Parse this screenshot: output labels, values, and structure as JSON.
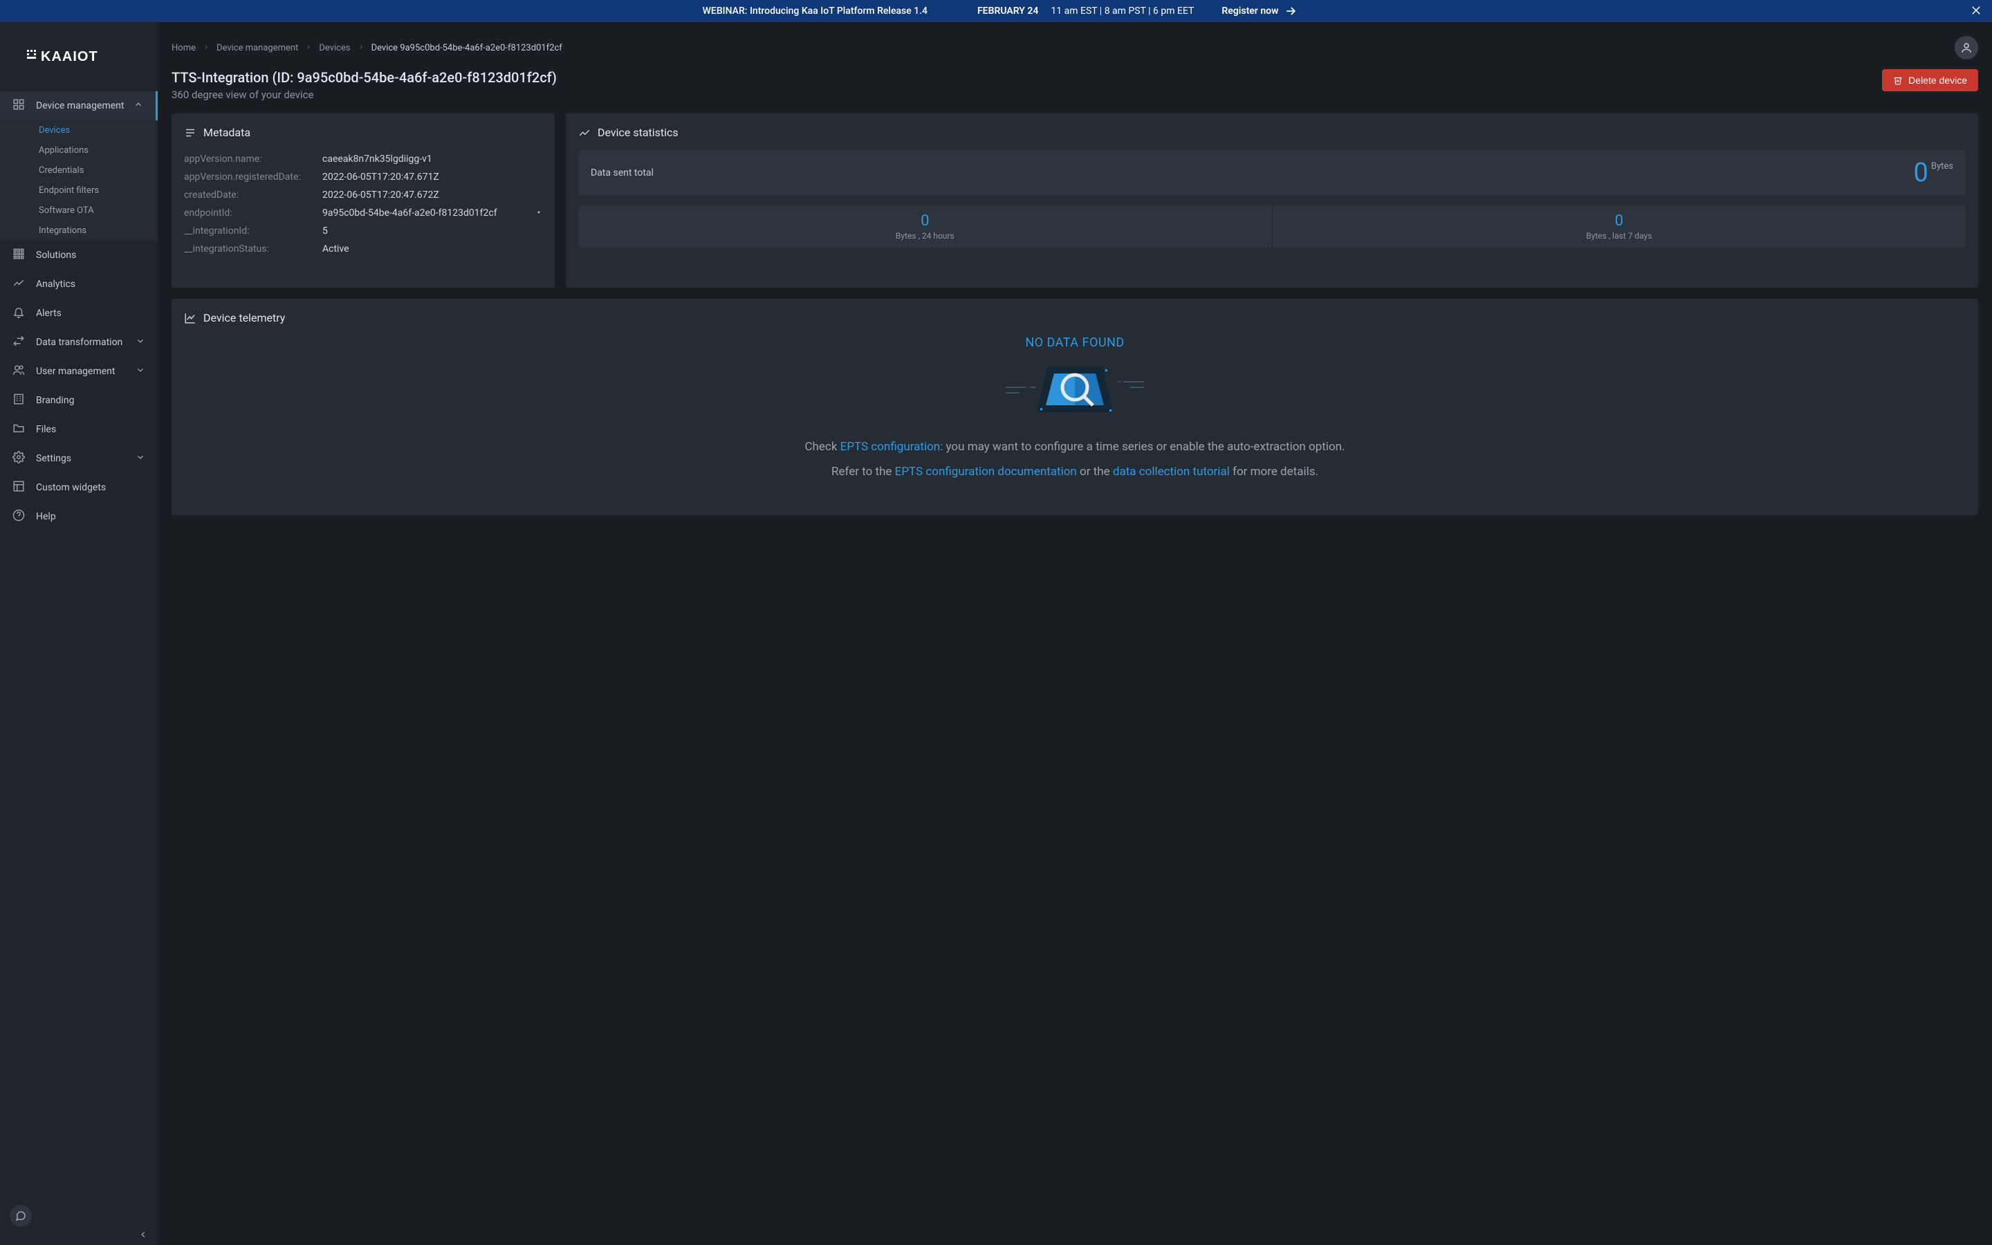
{
  "banner": {
    "text": "WEBINAR: Introducing Kaa IoT Platform Release 1.4",
    "date": "FEBRUARY 24",
    "times": "11 am EST   |   8 am PST   |   6 pm EET",
    "register": "Register now"
  },
  "brand": "KAAIOT",
  "sidebar": {
    "items": [
      {
        "label": "Device management",
        "icon": "grid-icon",
        "expandable": true,
        "active": true,
        "children": [
          {
            "label": "Devices",
            "active": true
          },
          {
            "label": "Applications"
          },
          {
            "label": "Credentials"
          },
          {
            "label": "Endpoint filters"
          },
          {
            "label": "Software OTA"
          },
          {
            "label": "Integrations"
          }
        ]
      },
      {
        "label": "Solutions",
        "icon": "grid3-icon"
      },
      {
        "label": "Analytics",
        "icon": "trend-icon"
      },
      {
        "label": "Alerts",
        "icon": "bell-icon"
      },
      {
        "label": "Data transformation",
        "icon": "swap-icon",
        "expandable": true
      },
      {
        "label": "User management",
        "icon": "people-icon",
        "expandable": true
      },
      {
        "label": "Branding",
        "icon": "building-icon"
      },
      {
        "label": "Files",
        "icon": "folder-icon"
      },
      {
        "label": "Settings",
        "icon": "gear-icon",
        "expandable": true
      },
      {
        "label": "Custom widgets",
        "icon": "layout-icon"
      },
      {
        "label": "Help",
        "icon": "help-icon"
      }
    ]
  },
  "breadcrumbs": [
    {
      "label": "Home"
    },
    {
      "label": "Device management"
    },
    {
      "label": "Devices"
    },
    {
      "label": "Device 9a95c0bd-54be-4a6f-a2e0-f8123d01f2cf",
      "current": true
    }
  ],
  "page": {
    "title": "TTS-Integration (ID: 9a95c0bd-54be-4a6f-a2e0-f8123d01f2cf)",
    "subtitle": "360 degree view of your device",
    "delete_label": "Delete device"
  },
  "metadata": {
    "title": "Metadata",
    "rows": [
      {
        "key": "appVersion.name:",
        "val": "caeeak8n7nk35lgdiigg-v1"
      },
      {
        "key": "appVersion.registeredDate:",
        "val": "2022-06-05T17:20:47.671Z"
      },
      {
        "key": "createdDate:",
        "val": "2022-06-05T17:20:47.672Z"
      },
      {
        "key": "endpointId:",
        "val": "9a95c0bd-54be-4a6f-a2e0-f8123d01f2cf",
        "dropdown": true
      },
      {
        "key": "__integrationId:",
        "val": "5"
      },
      {
        "key": "__integrationStatus:",
        "val": "Active"
      }
    ]
  },
  "stats": {
    "title": "Device statistics",
    "big_label": "Data sent total",
    "big_value": "0",
    "big_unit": "Bytes",
    "half1_value": "0",
    "half1_label": "Bytes , 24 hours",
    "half2_value": "0",
    "half2_label": "Bytes , last 7 days"
  },
  "telemetry": {
    "title": "Device telemetry",
    "nodata_title": "NO DATA FOUND",
    "msg1_lead": "Check ",
    "msg1_link": "EPTS configuration:",
    "msg1_rest": " you may want to configure a time series or enable the auto-extraction option.",
    "msg2_lead": "Refer to the ",
    "msg2_link1": "EPTS configuration documentation",
    "msg2_mid": " or the ",
    "msg2_link2": "data collection tutorial",
    "msg2_rest": " for more details."
  }
}
